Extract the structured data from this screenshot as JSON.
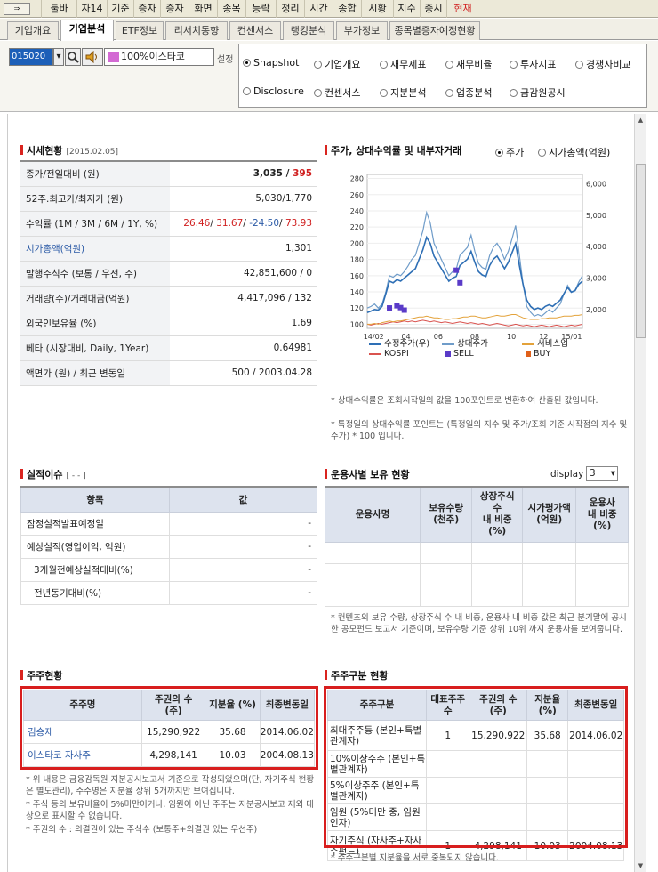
{
  "menubar": {
    "items": [
      "툴바",
      "자14",
      "기준",
      "증자",
      "증자",
      "화면",
      "종목",
      "등락",
      "정리",
      "시간",
      "종합",
      "시황",
      "지수",
      "증시",
      "현재"
    ]
  },
  "tabs": [
    "기업개요",
    "기업분석",
    "ETF정보",
    "리서치동향",
    "컨센서스",
    "랭킹분석",
    "부가정보",
    "종목별증자예정현황"
  ],
  "toolbar": {
    "code": "015020",
    "name": "100%이스타코",
    "settings_label": "설정",
    "radios": [
      {
        "label": "Snapshot",
        "checked": true
      },
      {
        "label": "기업개요",
        "checked": false
      },
      {
        "label": "재무제표",
        "checked": false
      },
      {
        "label": "재무비율",
        "checked": false
      },
      {
        "label": "투자지표",
        "checked": false
      },
      {
        "label": "경쟁사비교",
        "checked": false
      },
      {
        "label": "Disclosure",
        "checked": false
      },
      {
        "label": "컨센서스",
        "checked": false
      },
      {
        "label": "지분분석",
        "checked": false
      },
      {
        "label": "업종분석",
        "checked": false
      },
      {
        "label": "금감원공시",
        "checked": false
      }
    ]
  },
  "market": {
    "title": "시세현황",
    "date": "[2015.02.05]",
    "rows": [
      {
        "label": "종가/전일대비 (원)",
        "value": "3,035 / ",
        "value2": "395"
      },
      {
        "label": "52주.최고가/최저가 (원)",
        "value": "5,030/1,770"
      },
      {
        "label": "수익률 (1M / 3M / 6M / 1Y, %)",
        "v1": "26.46",
        "v2": "31.67",
        "v3": "-24.50",
        "v4": "73.93"
      },
      {
        "label": "시가총액(억원)",
        "value": "1,301"
      },
      {
        "label": "발행주식수 (보통 / 우선, 주)",
        "value": "42,851,600 / 0"
      },
      {
        "label": "거래량(주)/거래대금(억원)",
        "value": "4,417,096 / 132"
      },
      {
        "label": "외국인보유율 (%)",
        "value": "1.69"
      },
      {
        "label": "베타 (시장대비, Daily, 1Year)",
        "value": "0.64981"
      },
      {
        "label": "액면가 (원) / 최근 변동일",
        "value": "500 / 2003.04.28"
      }
    ]
  },
  "chart_section": {
    "title": "주가, 상대수익률 및 내부자거래",
    "radio1": "주가",
    "radio2": "시가총액(억원)",
    "notes": [
      "* 상대수익률은 조회시작일의 값을 100포인트로 변환하여 산출된 값입니다.",
      "* 특정일의 상대수익률 포인트는 (특정일의 지수 및 주가/조회 기준 시작점의 지수 및 주가) * 100 입니다."
    ]
  },
  "chart_data": {
    "type": "line",
    "x_ticks": [
      "14/02",
      "04",
      "06",
      "08",
      "10",
      "12",
      "15/01"
    ],
    "y_left_ticks": [
      100,
      120,
      140,
      160,
      180,
      200,
      220,
      240,
      260,
      280
    ],
    "y_right_ticks": [
      "2,000",
      "3,000",
      "4,000",
      "5,000",
      "6,000"
    ],
    "ylim_left": [
      95,
      285
    ],
    "ylim_right": [
      1400,
      6300
    ],
    "legend": [
      "수정주가(우)",
      "상대주가",
      "서비스업",
      "KOSPI",
      "SELL",
      "BUY"
    ],
    "colors": {
      "price": "#2e6fb5",
      "relative": "#6f9cc9",
      "sector": "#e3a23a",
      "kospi": "#d9534f",
      "sell": "#5a3bc8",
      "buy": "#e0601a"
    },
    "price_right_axis": [
      1900,
      1950,
      2000,
      1980,
      2100,
      2500,
      2900,
      2850,
      2950,
      2900,
      3000,
      3100,
      3200,
      3300,
      3600,
      3900,
      4300,
      4100,
      3700,
      3500,
      3300,
      3100,
      2900,
      3000,
      3050,
      3400,
      3500,
      3600,
      3850,
      3500,
      3200,
      3100,
      3050,
      3400,
      3600,
      3700,
      3500,
      3300,
      3500,
      3800,
      4100,
      3400,
      2800,
      2300,
      2100,
      2000,
      2050,
      2000,
      2100,
      2150,
      2100,
      2200,
      2300,
      2500,
      2700,
      2550,
      2600,
      2800,
      2900
    ],
    "relative": [
      120,
      122,
      125,
      120,
      125,
      140,
      160,
      158,
      162,
      160,
      165,
      172,
      180,
      185,
      200,
      215,
      238,
      225,
      200,
      190,
      180,
      170,
      160,
      165,
      168,
      185,
      190,
      195,
      210,
      190,
      175,
      170,
      168,
      185,
      195,
      200,
      192,
      180,
      190,
      205,
      222,
      185,
      150,
      122,
      115,
      110,
      112,
      110,
      114,
      118,
      115,
      120,
      125,
      137,
      148,
      140,
      142,
      152,
      160
    ],
    "sector": [
      100,
      100,
      101,
      100,
      102,
      103,
      104,
      103,
      104,
      104,
      105,
      106,
      107,
      108,
      109,
      109,
      110,
      109,
      108,
      108,
      107,
      106,
      106,
      107,
      107,
      108,
      109,
      109,
      110,
      110,
      109,
      108,
      108,
      109,
      110,
      111,
      110,
      110,
      111,
      112,
      112,
      110,
      108,
      107,
      106,
      106,
      106,
      107,
      107,
      108,
      108,
      108,
      109,
      110,
      110,
      110,
      111,
      111,
      112
    ],
    "kospi": [
      100,
      99,
      100,
      101,
      100,
      101,
      102,
      103,
      102,
      103,
      104,
      103,
      104,
      103,
      104,
      105,
      104,
      103,
      104,
      103,
      102,
      103,
      102,
      101,
      102,
      103,
      102,
      101,
      102,
      101,
      100,
      101,
      100,
      99,
      100,
      101,
      100,
      99,
      98,
      99,
      100,
      99,
      98,
      99,
      98,
      97,
      98,
      99,
      98,
      97,
      98,
      99,
      98,
      97,
      98,
      99,
      98,
      99,
      100
    ],
    "sell_points": [
      [
        6,
        2050
      ],
      [
        8,
        2120
      ],
      [
        9,
        2060
      ],
      [
        10,
        1980
      ],
      [
        24,
        3250
      ],
      [
        25,
        2850
      ]
    ],
    "buy_points": []
  },
  "earnings": {
    "title": "실적이슈",
    "sub": "[ - - ]",
    "headers": [
      "항목",
      "값"
    ],
    "rows": [
      {
        "label": "잠정실적발표예정일",
        "value": "-"
      },
      {
        "label": "예상실적(영업이익, 억원)",
        "value": "-"
      },
      {
        "label": "3개월전예상실적대비(%)",
        "value": "-"
      },
      {
        "label": "전년동기대비(%)",
        "value": "-"
      }
    ]
  },
  "funds": {
    "title": "운용사별 보유 현황",
    "display_label": "display",
    "display_value": "3",
    "headers": [
      "운용사명",
      "보유수량\n(천주)",
      "상장주식\n수\n내 비중\n(%)",
      "시가평가액\n(억원)",
      "운용사\n내 비중\n(%)"
    ],
    "note": "* 컨텐츠의 보유 수량, 상장주식 수 내 비중, 운용사 내 비중 값은 최근 분기말에 공시한 공모펀드 보고서 기준이며, 보유수량 기준 상위 10위 까지 운용사를 보여줍니다."
  },
  "shareholders": {
    "title": "주주현황",
    "headers": [
      "주주명",
      "주권의 수\n(주)",
      "지분율 (%)",
      "최종변동일"
    ],
    "rows": [
      {
        "name": "김승제",
        "shares": "15,290,922",
        "ratio": "35.68",
        "date": "2014.06.02"
      },
      {
        "name": "이스타코 자사주",
        "shares": "4,298,141",
        "ratio": "10.03",
        "date": "2004.08.13"
      }
    ],
    "notes": [
      "* 위 내용은 금융감독원 지분공시보고서 기준으로 작성되었으며(단, 자기주식 현황은 별도관리), 주주명은 지분율 상위 5개까지만 보여집니다.",
      "* 주식 등의 보유비율이 5%미만이거나, 임원이 아닌 주주는 지분공시보고 제외 대상으로 표시할 수 없습니다.",
      "* 주권의 수 : 의결권이 있는 주식수 (보통주+의결권 있는 우선주)"
    ]
  },
  "shareholder_types": {
    "title": "주주구분 현황",
    "headers": [
      "주주구분",
      "대표주주수",
      "주권의 수\n(주)",
      "지분율\n(%)",
      "최종변동일"
    ],
    "rows": [
      {
        "type": "최대주주등 (본인+특별관계자)",
        "count": "1",
        "shares": "15,290,922",
        "ratio": "35.68",
        "date": "2014.06.02"
      },
      {
        "type": "10%이상주주 (본인+특별관계자)",
        "count": "",
        "shares": "",
        "ratio": "",
        "date": ""
      },
      {
        "type": "5%이상주주 (본인+특별관계자)",
        "count": "",
        "shares": "",
        "ratio": "",
        "date": ""
      },
      {
        "type": "임원 (5%미만 중, 임원인자)",
        "count": "",
        "shares": "",
        "ratio": "",
        "date": ""
      },
      {
        "type": "자기주식 (자사주+자사주펀드)",
        "count": "1",
        "shares": "4,298,141",
        "ratio": "10.03",
        "date": "2004.08.13"
      }
    ],
    "note": "* 주주구분별 지분율을 서로 중복되지 않습니다."
  }
}
